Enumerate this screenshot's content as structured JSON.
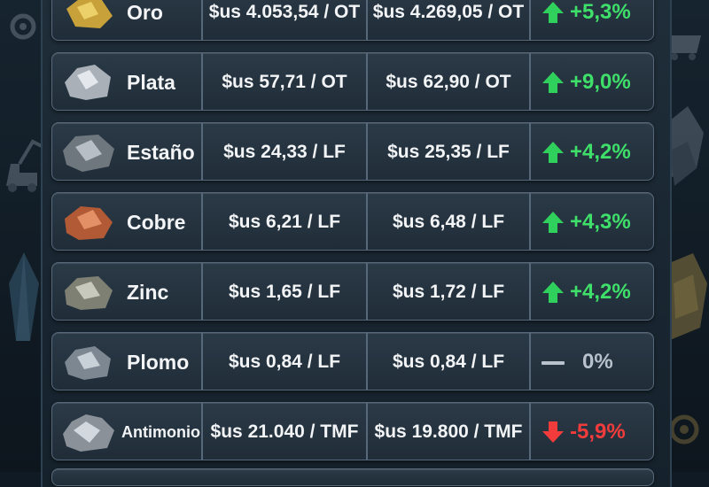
{
  "colors": {
    "up": "#3fe06a",
    "down": "#f23c3c",
    "flat": "#b8c2cc"
  },
  "rows": [
    {
      "metal": "Oro",
      "price_prev": "$us 4.053,54 / OT",
      "price_now": "$us 4.269,05 / OT",
      "change": "+5,3%",
      "trend": "up"
    },
    {
      "metal": "Plata",
      "price_prev": "$us 57,71 / OT",
      "price_now": "$us 62,90 / OT",
      "change": "+9,0%",
      "trend": "up"
    },
    {
      "metal": "Estaño",
      "price_prev": "$us 24,33 / LF",
      "price_now": "$us 25,35 / LF",
      "change": "+4,2%",
      "trend": "up"
    },
    {
      "metal": "Cobre",
      "price_prev": "$us 6,21 / LF",
      "price_now": "$us 6,48 / LF",
      "change": "+4,3%",
      "trend": "up"
    },
    {
      "metal": "Zinc",
      "price_prev": "$us 1,65 / LF",
      "price_now": "$us 1,72 / LF",
      "change": "+4,2%",
      "trend": "up"
    },
    {
      "metal": "Plomo",
      "price_prev": "$us 0,84 / LF",
      "price_now": "$us 0,84 / LF",
      "change": "0%",
      "trend": "flat"
    },
    {
      "metal": "Antimonio",
      "price_prev": "$us 21.040 / TMF",
      "price_now": "$us 19.800 / TMF",
      "change": "-5,9%",
      "trend": "down"
    }
  ]
}
